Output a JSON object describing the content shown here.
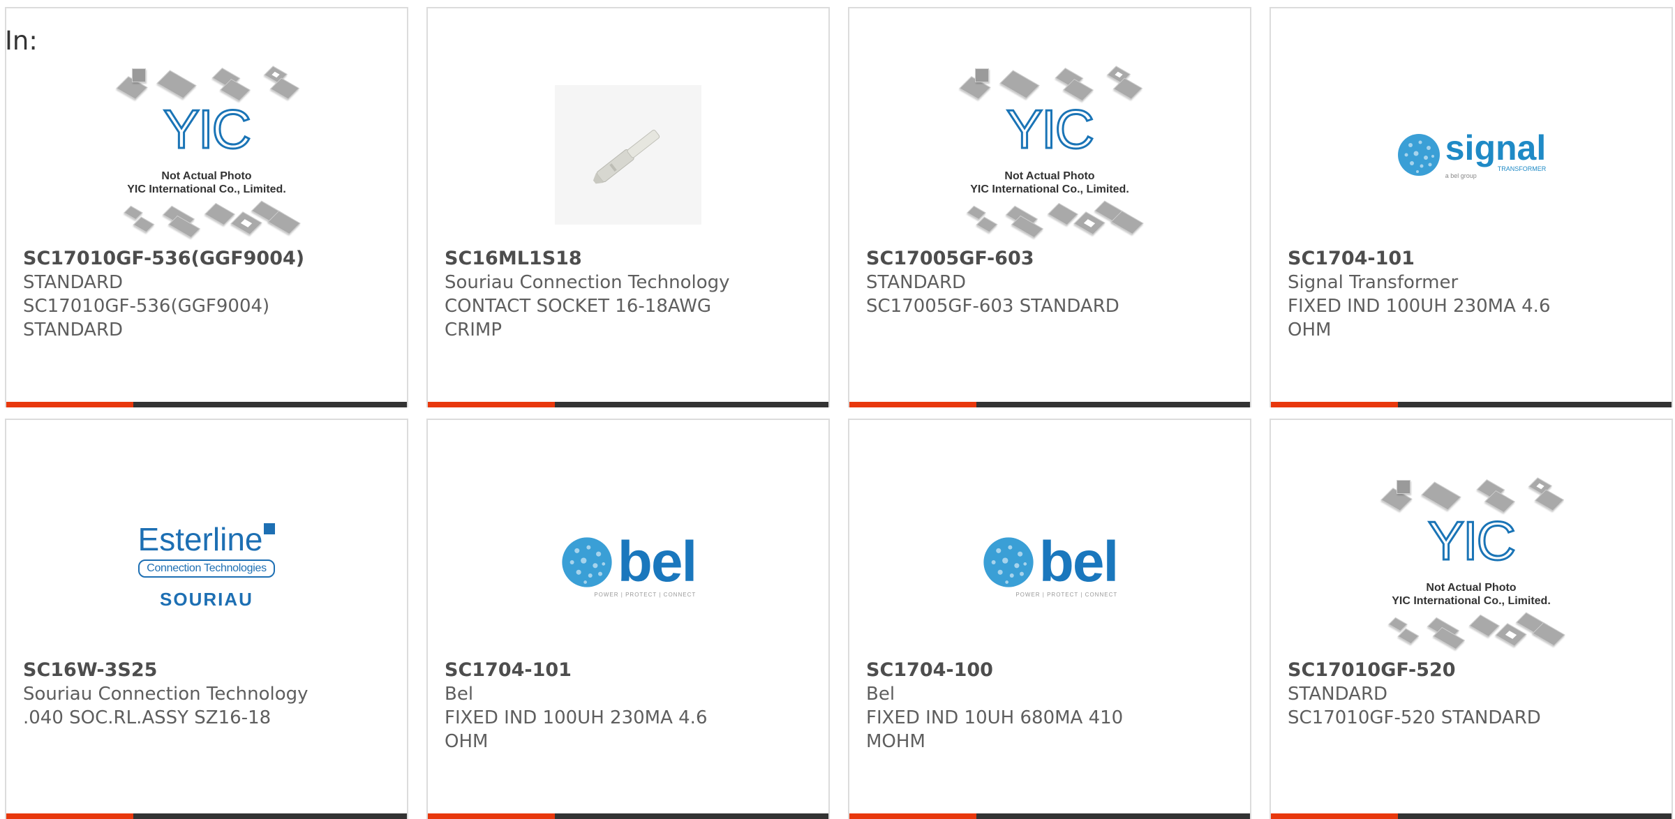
{
  "header": {
    "label": "In:"
  },
  "colors": {
    "accent": "#e8380d",
    "bar": "#333333",
    "logo_blue": "#1a74b6"
  },
  "yic_placeholder": {
    "logo": "YIC",
    "line1": "Not Actual Photo",
    "line2": "YIC International Co., Limited."
  },
  "logos": {
    "signal": {
      "word": "signal",
      "sub1": "TRANSFORMER",
      "sub2": "a bel group"
    },
    "esterline": {
      "e1": "Esterline",
      "e2": "Connection Technologies",
      "e3": "SOURIAU"
    },
    "bel": {
      "word": "bel",
      "tag": "POWER | PROTECT | CONNECT"
    }
  },
  "products": [
    {
      "part": "SC17010GF-536(GGF9004)",
      "maker": "STANDARD",
      "desc1": "SC17010GF-536(GGF9004)",
      "desc2": "STANDARD",
      "image": "yic-placeholder"
    },
    {
      "part": "SC16ML1S18",
      "maker": "Souriau Connection Technology",
      "desc1": "CONTACT SOCKET 16-18AWG",
      "desc2": "CRIMP",
      "image": "pin-contact"
    },
    {
      "part": "SC17005GF-603",
      "maker": "STANDARD",
      "desc1": "SC17005GF-603 STANDARD",
      "desc2": "",
      "image": "yic-placeholder"
    },
    {
      "part": "SC1704-101",
      "maker": "Signal Transformer",
      "desc1": "FIXED IND 100UH 230MA 4.6",
      "desc2": "OHM",
      "image": "signal-logo"
    },
    {
      "part": "SC16W-3S25",
      "maker": "Souriau Connection Technology",
      "desc1": ".040 SOC.RL.ASSY SZ16-18",
      "desc2": "",
      "image": "esterline-logo"
    },
    {
      "part": "SC1704-101",
      "maker": "Bel",
      "desc1": "FIXED IND 100UH 230MA 4.6",
      "desc2": "OHM",
      "image": "bel-logo"
    },
    {
      "part": "SC1704-100",
      "maker": "Bel",
      "desc1": "FIXED IND 10UH 680MA 410",
      "desc2": "MOHM",
      "image": "bel-logo"
    },
    {
      "part": "SC17010GF-520",
      "maker": "STANDARD",
      "desc1": "SC17010GF-520 STANDARD",
      "desc2": "",
      "image": "yic-placeholder"
    }
  ]
}
